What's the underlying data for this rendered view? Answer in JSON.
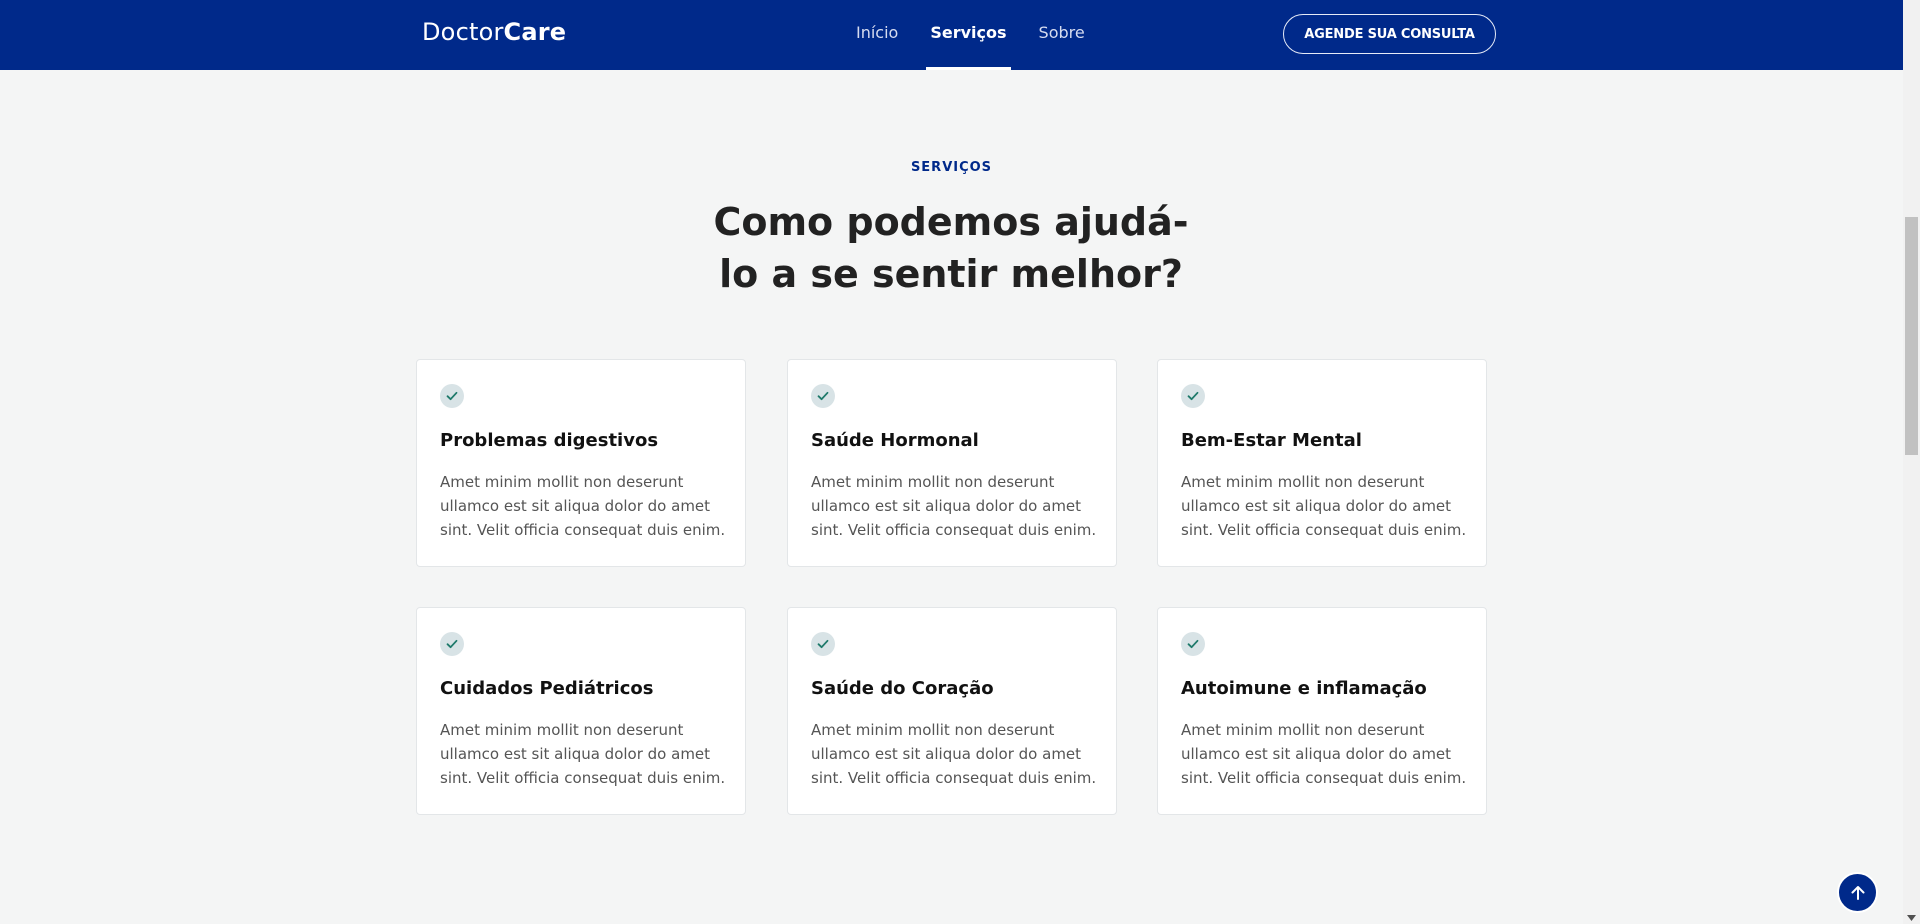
{
  "header": {
    "logo_light": "Doctor",
    "logo_bold": "Care",
    "nav": [
      {
        "label": "Início",
        "active": false
      },
      {
        "label": "Serviços",
        "active": true
      },
      {
        "label": "Sobre",
        "active": false
      }
    ],
    "cta_label": "AGENDE SUA CONSULTA"
  },
  "services": {
    "eyebrow": "SERVIÇOS",
    "heading_line1": "Como podemos ajudá-",
    "heading_line2": "lo a se sentir melhor?",
    "cards": [
      {
        "title": "Problemas digestivos",
        "text": "Amet minim mollit non deserunt ullamco est sit aliqua dolor do amet sint. Velit officia consequat duis enim.",
        "icon": "check-icon"
      },
      {
        "title": "Saúde Hormonal",
        "text": "Amet minim mollit non deserunt ullamco est sit aliqua dolor do amet sint. Velit officia consequat duis enim.",
        "icon": "check-icon"
      },
      {
        "title": "Bem-Estar Mental",
        "text": "Amet minim mollit non deserunt ullamco est sit aliqua dolor do amet sint. Velit officia consequat duis enim.",
        "icon": "check-icon"
      },
      {
        "title": "Cuidados Pediátricos",
        "text": "Amet minim mollit non deserunt ullamco est sit aliqua dolor do amet sint. Velit officia consequat duis enim.",
        "icon": "check-icon"
      },
      {
        "title": "Saúde do Coração",
        "text": "Amet minim mollit non deserunt ullamco est sit aliqua dolor do amet sint. Velit officia consequat duis enim.",
        "icon": "check-icon"
      },
      {
        "title": "Autoimune e inflamação",
        "text": "Amet minim mollit non deserunt ullamco est sit aliqua dolor do amet sint. Velit officia consequat duis enim.",
        "icon": "check-icon"
      }
    ]
  },
  "colors": {
    "primary": "#00298a",
    "background": "#f4f5f5",
    "card": "#ffffff",
    "icon_bg": "#d8e3e6",
    "icon_check": "#1f7a6b"
  },
  "back_to_top_icon": "arrow-up-icon"
}
